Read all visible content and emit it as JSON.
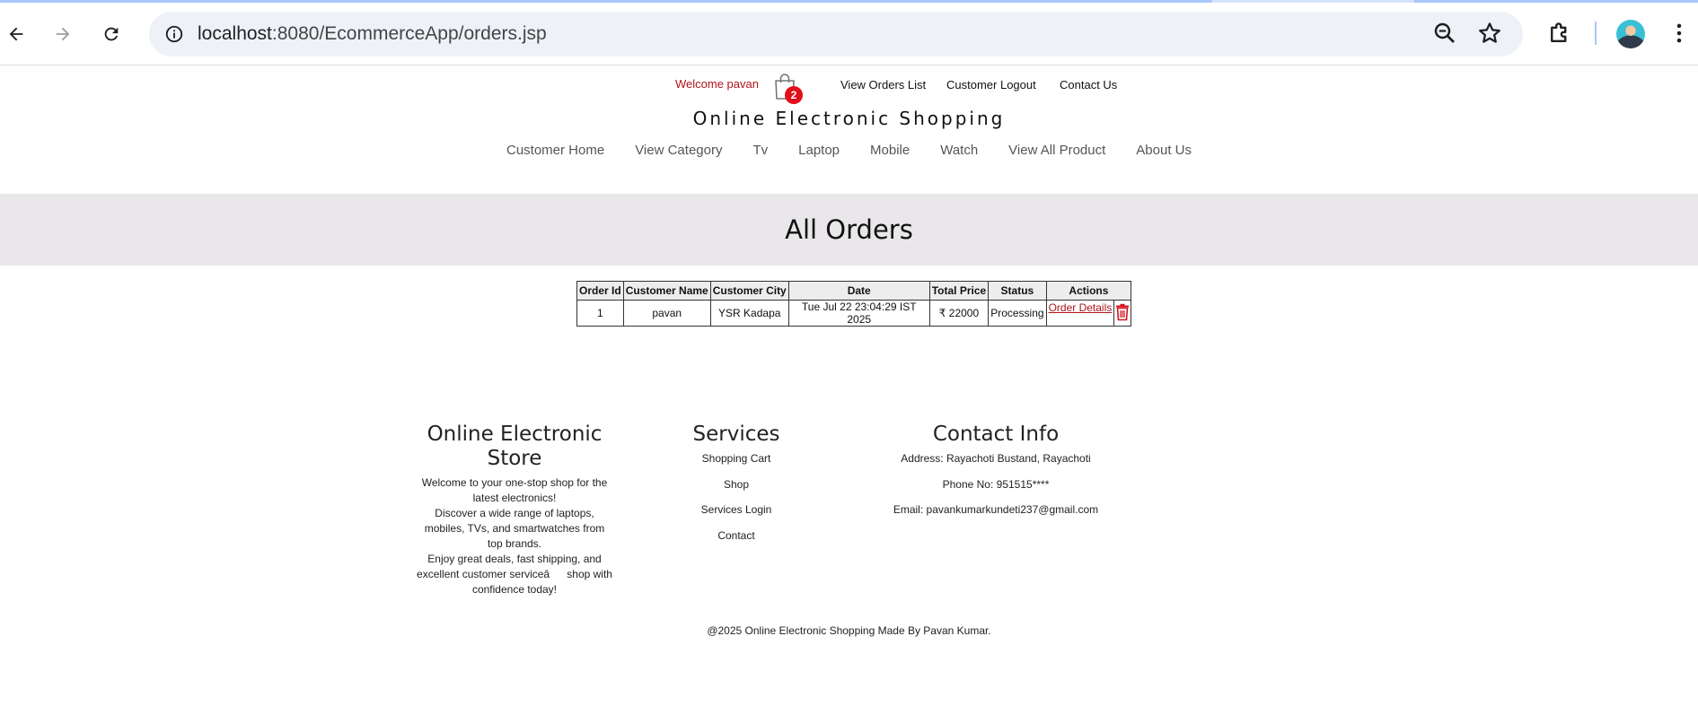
{
  "browser": {
    "url_host": "localhost",
    "url_path": ":8080/EcommerceApp/orders.jsp",
    "icons": [
      "back-icon",
      "forward-icon",
      "reload-icon",
      "info-icon",
      "zoom-icon",
      "star-icon",
      "extensions-icon",
      "avatar",
      "menu-icon"
    ]
  },
  "header": {
    "welcome": "Welcome pavan",
    "cart_count": "2",
    "links": [
      "View Orders List",
      "Customer Logout",
      "Contact Us"
    ],
    "site_title": "Online Electronic Shopping",
    "nav": [
      "Customer Home",
      "View Category",
      "Tv",
      "Laptop",
      "Mobile",
      "Watch",
      "View All Product",
      "About Us"
    ]
  },
  "page": {
    "title": "All Orders"
  },
  "orders": {
    "columns": [
      "Order Id",
      "Customer Name",
      "Customer City",
      "Date",
      "Total Price",
      "Status",
      "Actions"
    ],
    "rows": [
      {
        "id": "1",
        "name": "pavan",
        "city": "YSR Kadapa",
        "date": "Tue Jul 22 23:04:29 IST 2025",
        "price": "₹ 22000",
        "status": "Processing",
        "details_label": "Order Details"
      }
    ]
  },
  "footer": {
    "store": {
      "title": "Online Electronic Store",
      "lines": [
        "Welcome to your one-stop shop for the latest electronics!",
        "Discover a wide range of laptops, mobiles, TVs, and smartwatches from top brands.",
        "Enjoy great deals, fast shipping, and excellent customer serviceâshop with confidence today!"
      ]
    },
    "services": {
      "title": "Services",
      "items": [
        "Shopping Cart",
        "Shop",
        "Services Login",
        "Contact"
      ]
    },
    "contact": {
      "title": "Contact Info",
      "address": "Address: Rayachoti Bustand, Rayachoti",
      "phone": "Phone No: 951515****",
      "email": "Email: pavankumarkundeti237@gmail.com"
    },
    "copyright": "@2025 Online Electronic Shopping Made By Pavan Kumar."
  },
  "colors": {
    "accent_red": "#b0121b",
    "banner_bg": "#e9e7ea",
    "omnibox_bg": "#eef2f8"
  }
}
